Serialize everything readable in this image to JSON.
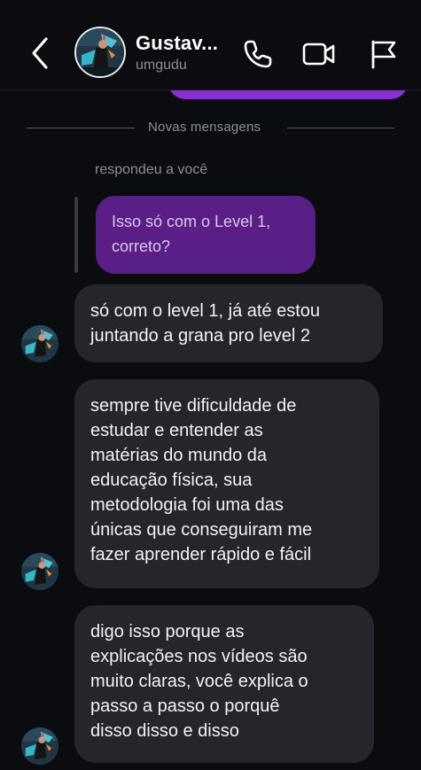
{
  "header": {
    "user_name": "Gustav...",
    "user_handle": "umgudu",
    "icons": [
      "back-chevron-icon",
      "phone-icon",
      "video-camera-icon",
      "flag-icon"
    ]
  },
  "divider": {
    "label": "Novas mensagens"
  },
  "reply": {
    "note": "respondeu a você",
    "quoted_text": "Isso só com o Level 1,\ncorreto?"
  },
  "messages": [
    {
      "text": "só com o level 1, já até estou\njuntando a grana pro level 2"
    },
    {
      "text": "sempre tive dificuldade de\nestudar e entender as\nmatérias do mundo da\neducação física, sua\nmetodologia foi uma das\núnicas que conseguiram me\nfazer aprender rápido e fácil"
    },
    {
      "text": "digo isso porque as\nexplicações nos vídeos são\nmuito claras, você explica o\npasso a passo o porquê\ndisso disso e disso"
    }
  ],
  "colors": {
    "background": "#0b0c10",
    "outgoing_bubble": "#8a2fd0",
    "quoted_bubble": "#5a1f86",
    "incoming_bubble": "#25262c",
    "muted_text": "#8d8e96"
  }
}
